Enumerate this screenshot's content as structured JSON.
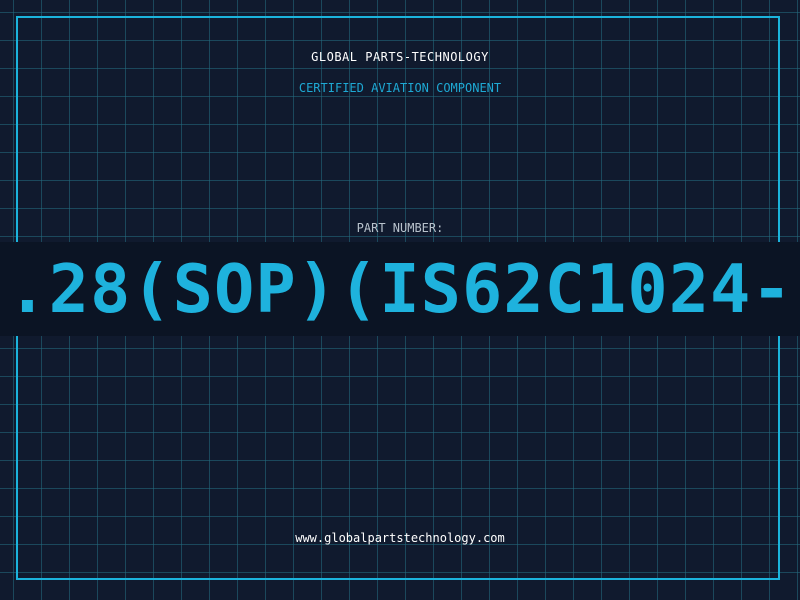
{
  "header": {
    "brand": "GLOBAL PARTS-TECHNOLOGY",
    "subtitle": "CERTIFIED AVIATION COMPONENT"
  },
  "part": {
    "label": "PART NUMBER:",
    "number": ".28(SOP)(IS62C1024-"
  },
  "footer": {
    "website": "www.globalpartstechnology.com"
  },
  "colors": {
    "background": "#101a2e",
    "grid": "#246e82",
    "accent": "#1eb2dd",
    "band": "#0b1424",
    "text": "#ffffff",
    "label": "#b8c2cc"
  }
}
